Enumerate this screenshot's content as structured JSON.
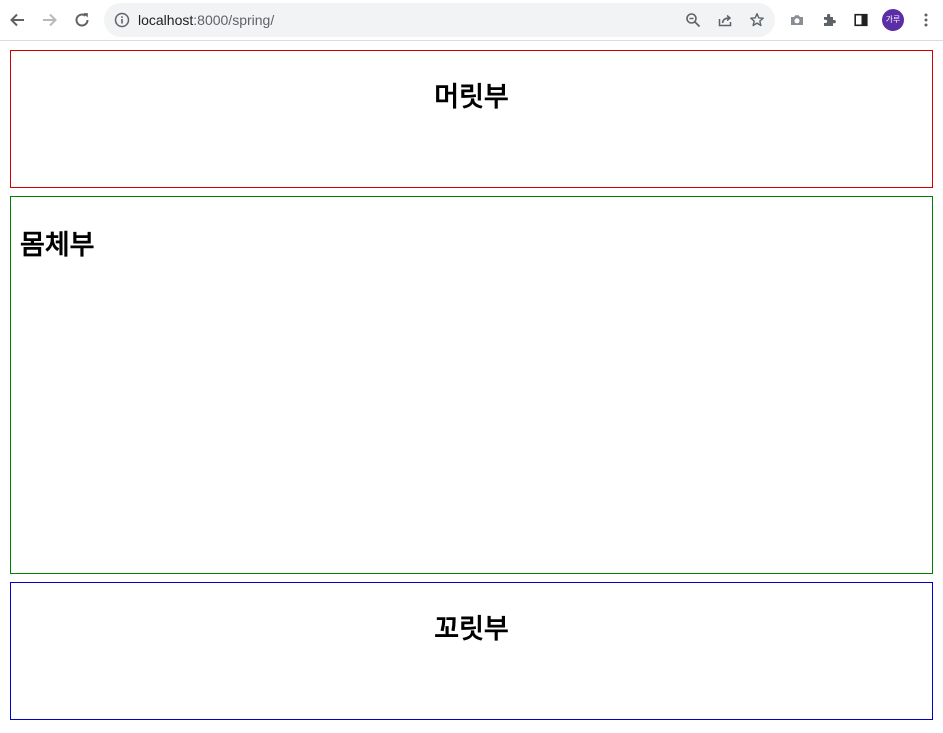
{
  "browser": {
    "url_host": "localhost",
    "url_path": ":8000/spring/",
    "avatar_label": "가루",
    "icons": [
      "back-icon",
      "forward-icon",
      "reload-icon",
      "info-icon",
      "zoom-icon",
      "share-icon",
      "star-icon",
      "camera-icon",
      "extensions-icon",
      "side-panel-icon",
      "menu-icon"
    ]
  },
  "page": {
    "header_title": "머릿부",
    "body_title": "몸체부",
    "footer_title": "꼬릿부"
  },
  "colors": {
    "header_border": "#d00000",
    "body_border": "#008000",
    "footer_border": "#0000c8"
  }
}
